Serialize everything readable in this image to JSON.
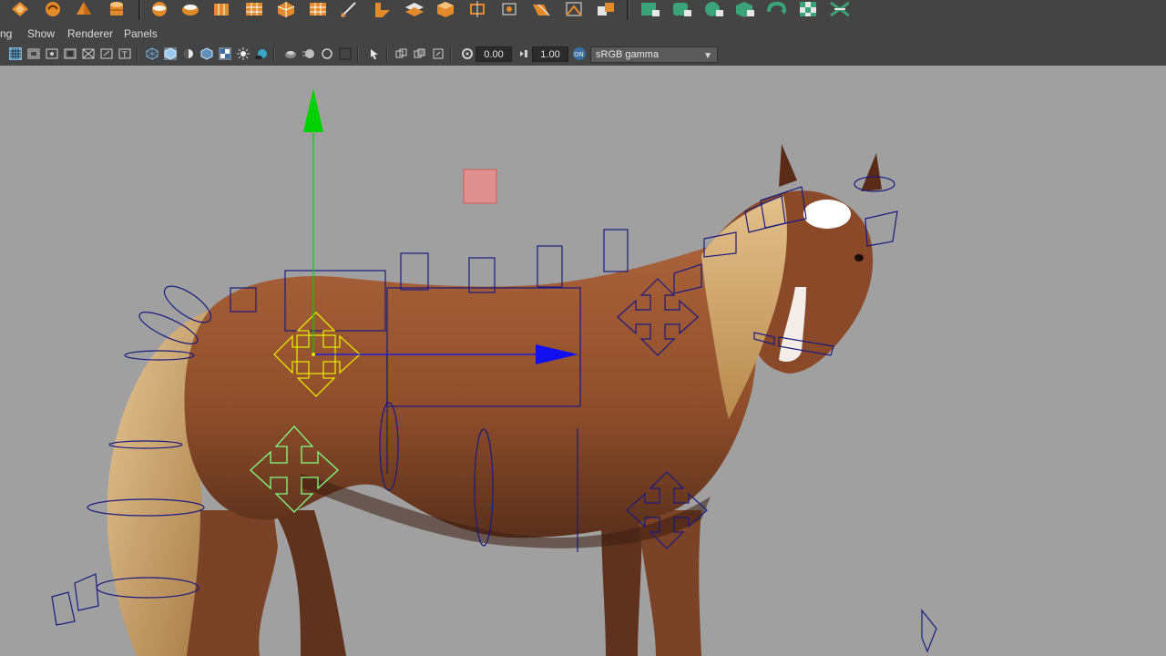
{
  "menu": {
    "partial_item": "ng",
    "show": "Show",
    "renderer": "Renderer",
    "panels": "Panels"
  },
  "toolbar": {
    "exposure_value": "0.00",
    "gamma_value": "1.00",
    "color_space": "sRGB gamma"
  },
  "icons": {
    "shelf_left": [
      "poly-cube-icon",
      "sculpt-icon",
      "cone-icon",
      "cylinder-icon",
      "layer-icon",
      "extrude-icon",
      "bevel-icon",
      "bridge-icon",
      "append-icon",
      "split-icon",
      "grid-icon",
      "knife-icon",
      "wedge-icon",
      "combine-icon",
      "separate-icon",
      "cut-icon",
      "target-weld-icon",
      "merge-icon",
      "edge-loop-icon",
      "smooth-icon"
    ],
    "shelf_right": [
      "uv-planar-icon",
      "uv-cylindrical-icon",
      "uv-spherical-icon",
      "uv-auto-icon",
      "uv-unfold-icon",
      "uv-checker-icon",
      "uv-layout-icon"
    ]
  },
  "colors": {
    "ui_bg": "#444444",
    "viewport_bg": "#a0a0a0",
    "shelf_orange": "#e38a2a",
    "shelf_green": "#3aa37a",
    "rig_blue": "#1a1a80",
    "manip_yellow": "#e6e600",
    "manip_green": "#80ff80",
    "axis_green": "#00d000",
    "axis_blue": "#1010f0"
  }
}
